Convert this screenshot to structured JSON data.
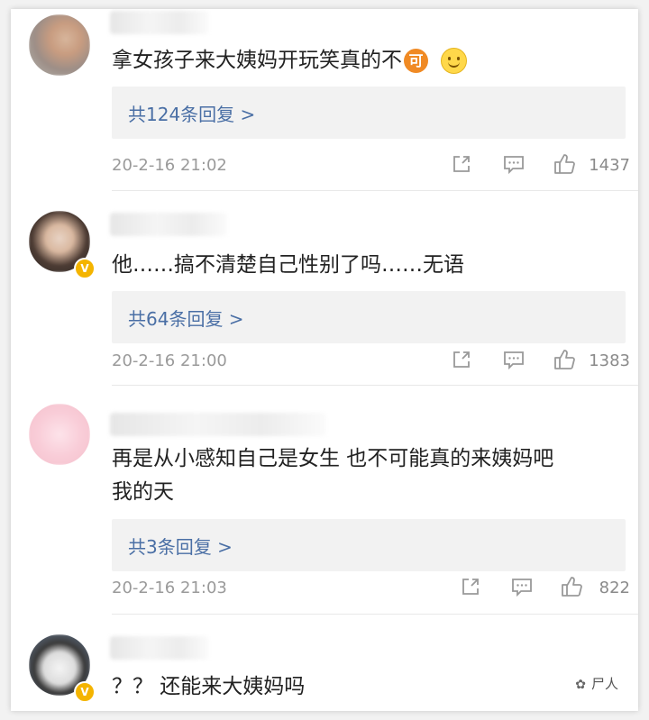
{
  "comments": [
    {
      "text": "拿女孩子来大姨妈开玩笑真的不",
      "emoji_ke": "可",
      "replies": "共124条回复 >",
      "time": "20-2-16 21:02",
      "likes": "1437"
    },
    {
      "text": "他……搞不清楚自己性别了吗……无语",
      "replies": "共64条回复 >",
      "time": "20-2-16 21:00",
      "likes": "1383",
      "verified": "V"
    },
    {
      "text_line1": "再是从小感知自己是女生  也不可能真的来姨妈吧",
      "text_line2": "我的天",
      "replies": "共3条回复 >",
      "time": "20-2-16 21:03",
      "likes": "822"
    },
    {
      "text": "？？ 还能来大姨妈吗",
      "verified": "V"
    }
  ],
  "icons": [
    "share-icon",
    "comment-icon",
    "like-icon",
    "wechat-icon"
  ],
  "watermark": "尸人"
}
